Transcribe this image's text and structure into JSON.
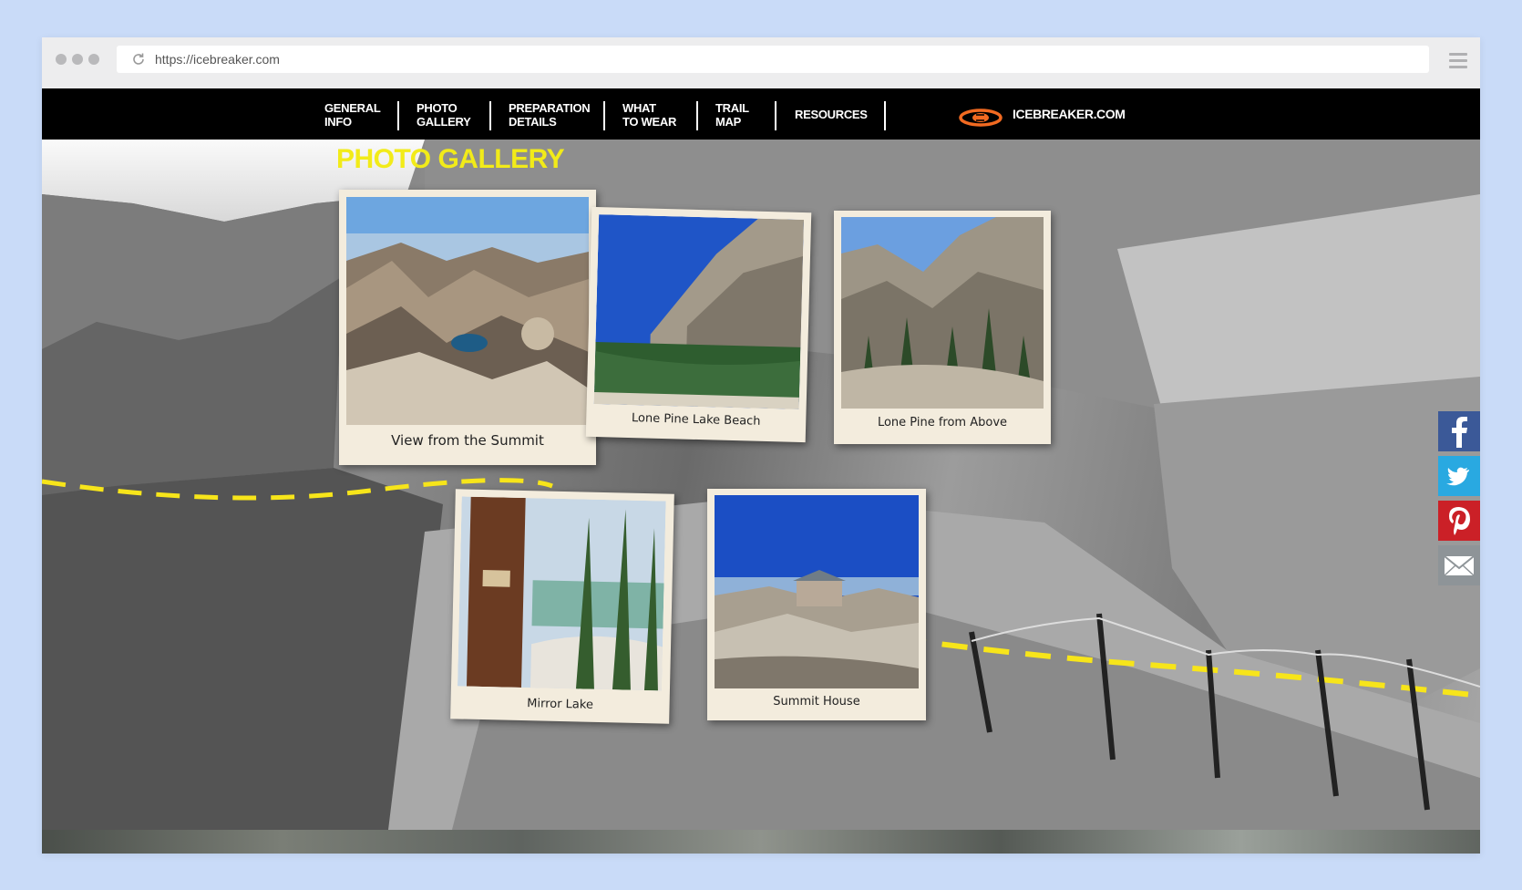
{
  "browser": {
    "url": "https://icebreaker.com",
    "controls": [
      "window-dot",
      "window-dot",
      "window-dot"
    ]
  },
  "nav": {
    "items": [
      {
        "label_line1": "GENERAL",
        "label_line2": "INFO"
      },
      {
        "label_line1": "PHOTO",
        "label_line2": "GALLERY"
      },
      {
        "label_line1": "PREPARATION",
        "label_line2": "DETAILS"
      },
      {
        "label_line1": "WHAT",
        "label_line2": "TO WEAR"
      },
      {
        "label_line1": "TRAIL",
        "label_line2": "MAP"
      },
      {
        "label_line1": "RESOURCES",
        "label_line2": ""
      }
    ],
    "brand_label": "ICEBREAKER.COM",
    "brand_icon": "icebreaker-logo-icon"
  },
  "gallery": {
    "title": "PHOTO GALLERY",
    "photos": [
      {
        "caption": "View from the Summit",
        "scene": "summit-view"
      },
      {
        "caption": "Lone Pine Lake Beach",
        "scene": "lake-beach"
      },
      {
        "caption": "Lone Pine from Above",
        "scene": "pine-above"
      },
      {
        "caption": "Mirror Lake",
        "scene": "mirror-lake"
      },
      {
        "caption": "Summit House",
        "scene": "summit-house"
      }
    ]
  },
  "social": [
    {
      "name": "facebook-icon",
      "color": "#3b5998"
    },
    {
      "name": "twitter-icon",
      "color": "#29a9e1"
    },
    {
      "name": "pinterest-icon",
      "color": "#cb2027"
    },
    {
      "name": "email-icon",
      "color": "#8e9498"
    }
  ],
  "colors": {
    "title_yellow": "#f2eb19",
    "trail_yellow": "#f7e51a",
    "nav_bg": "#000000",
    "page_bg": "#c9dbf8"
  }
}
